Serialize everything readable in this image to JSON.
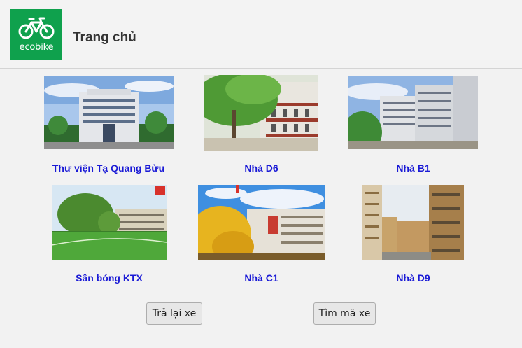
{
  "header": {
    "logo_text": "ecobike",
    "logo_icon": "bicycle-icon",
    "title": "Trang chủ"
  },
  "colors": {
    "brand_green": "#0fa14d",
    "link_blue": "#1a1ad6"
  },
  "locations": [
    {
      "label": "Thư viện Tạ Quang Bửu"
    },
    {
      "label": "Nhà D6"
    },
    {
      "label": "Nhà B1"
    },
    {
      "label": "Sân bóng KTX"
    },
    {
      "label": "Nhà C1"
    },
    {
      "label": "Nhà D9"
    }
  ],
  "actions": {
    "return_bike": "Trả lại xe",
    "find_code": "Tìm mã xe"
  }
}
